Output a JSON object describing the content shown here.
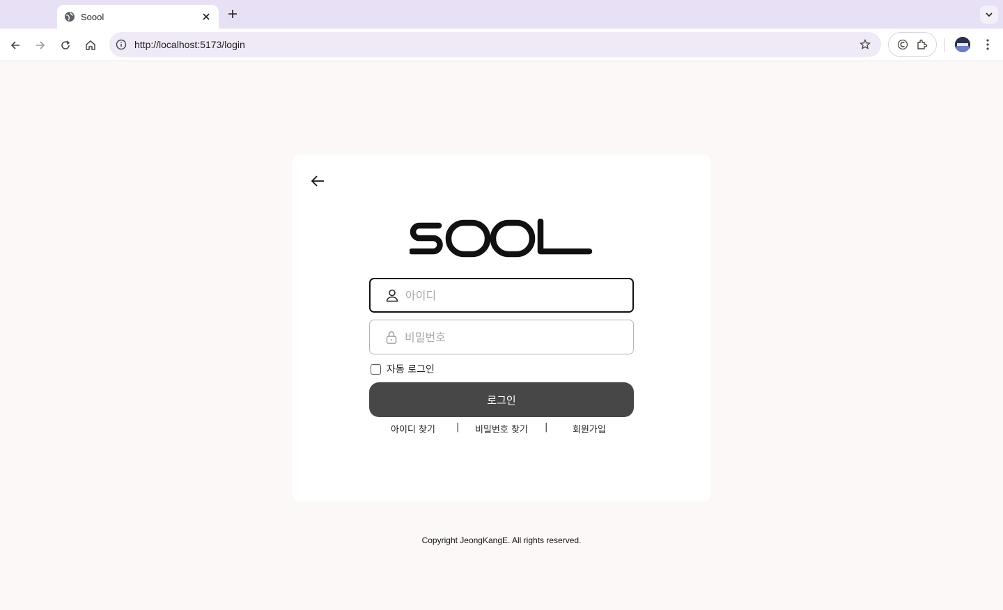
{
  "browser": {
    "tab_title": "Soool",
    "url": "http://localhost:5173/login"
  },
  "login": {
    "id_placeholder": "아이디",
    "password_placeholder": "비밀번호",
    "remember_label": "자동 로그인",
    "submit_label": "로그인",
    "links": {
      "find_id": "아이디 찾기",
      "find_password": "비밀번호 찾기",
      "signup": "회원가입",
      "separator": "|"
    }
  },
  "logo_text": "SOOOL",
  "footer": {
    "copyright": "Copyright JeongKangE. All rights reserved."
  },
  "colors": {
    "page_bg": "#fdf8f8",
    "tab_strip": "#e8e1f5",
    "button_bg": "#474747",
    "omnibox": "#efeaf6"
  },
  "icons": [
    "globe-icon",
    "close-icon",
    "plus-icon",
    "chevron-down-icon",
    "back-arrow-icon",
    "forward-arrow-icon",
    "reload-icon",
    "home-icon",
    "info-icon",
    "star-icon",
    "extension-icon",
    "puzzle-icon",
    "kebab-icon",
    "arrow-left-icon",
    "user-icon",
    "lock-icon"
  ]
}
